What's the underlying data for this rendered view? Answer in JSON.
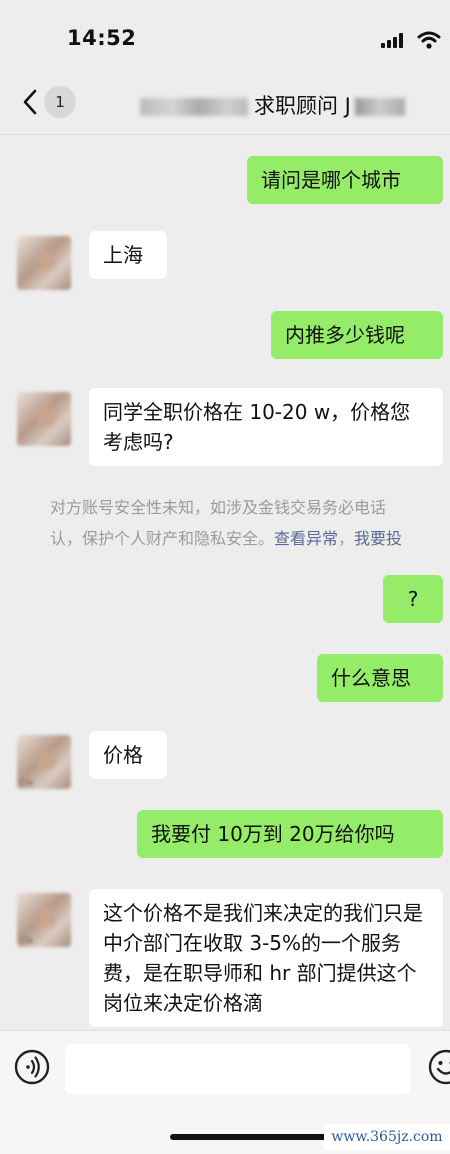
{
  "status": {
    "time": "14:52"
  },
  "header": {
    "back_count": "1",
    "title_suffix": "求职顾问 J"
  },
  "messages": [
    {
      "dir": "out",
      "text": "请问是哪个城市"
    },
    {
      "dir": "in",
      "text": "上海"
    },
    {
      "dir": "out",
      "text": "内推多少钱呢"
    },
    {
      "dir": "in",
      "text": "同学全职价格在 10-20 w，价格您考虑吗?"
    },
    {
      "dir": "out",
      "text": "?"
    },
    {
      "dir": "out",
      "text": "什么意思"
    },
    {
      "dir": "in",
      "text": "价格"
    },
    {
      "dir": "out",
      "text": "我要付 10万到 20万给你吗"
    },
    {
      "dir": "in",
      "text": "这个价格不是我们来决定的我们只是中介部门在收取 3-5%的一个服务费，是在职导师和 hr 部门提供这个岗位来决定价格滴"
    }
  ],
  "notice": {
    "line1": "对方账号安全性未知，如涉及金钱交易务必电话",
    "line2": "认，保护个人财产和隐私安全。",
    "link1": "查看异常",
    "sep": "，",
    "link2": "我要投"
  },
  "avatar_label": "Cla",
  "watermark": "www.365jz.com"
}
